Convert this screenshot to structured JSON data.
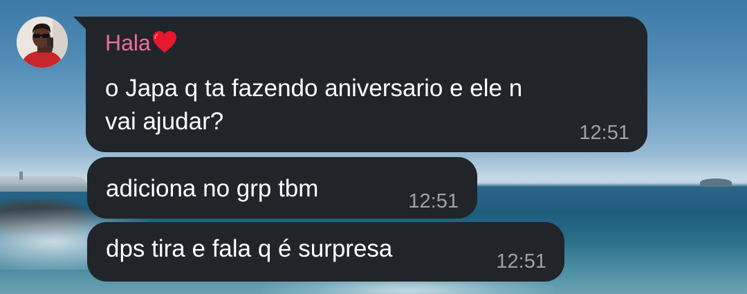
{
  "chat": {
    "sender": {
      "name": "Hala",
      "name_color": "#ee6e9c",
      "emoji_icon": "red-heart-icon",
      "avatar": "user-avatar"
    },
    "bubble_color": "#212529",
    "time_color": "#9ea3a8",
    "messages": [
      {
        "lines": [
          "o Japa q ta fazendo aniversario e ele n",
          "vai ajudar?"
        ],
        "time": "12:51"
      },
      {
        "lines": [
          "adiciona no grp tbm"
        ],
        "time": "12:51"
      },
      {
        "lines": [
          "dps tira e fala q é surpresa"
        ],
        "time": "12:51"
      }
    ]
  }
}
